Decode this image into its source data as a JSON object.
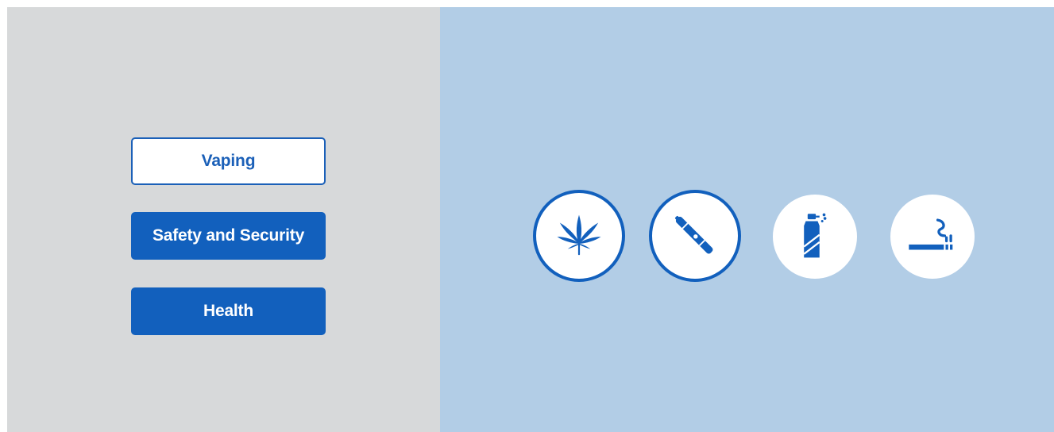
{
  "colors": {
    "left_panel_bg": "#d7d9da",
    "right_panel_bg": "#b2cde6",
    "primary_blue": "#1260bd",
    "white": "#ffffff"
  },
  "topic_buttons": [
    {
      "label": "Vaping",
      "state": "selected"
    },
    {
      "label": "Safety and Security",
      "state": "default"
    },
    {
      "label": "Health",
      "state": "default"
    }
  ],
  "icons": [
    {
      "name": "cannabis-leaf-icon",
      "style": "ringed"
    },
    {
      "name": "vape-pen-icon",
      "style": "ringed"
    },
    {
      "name": "spray-can-icon",
      "style": "plain"
    },
    {
      "name": "cigarette-icon",
      "style": "plain"
    }
  ]
}
